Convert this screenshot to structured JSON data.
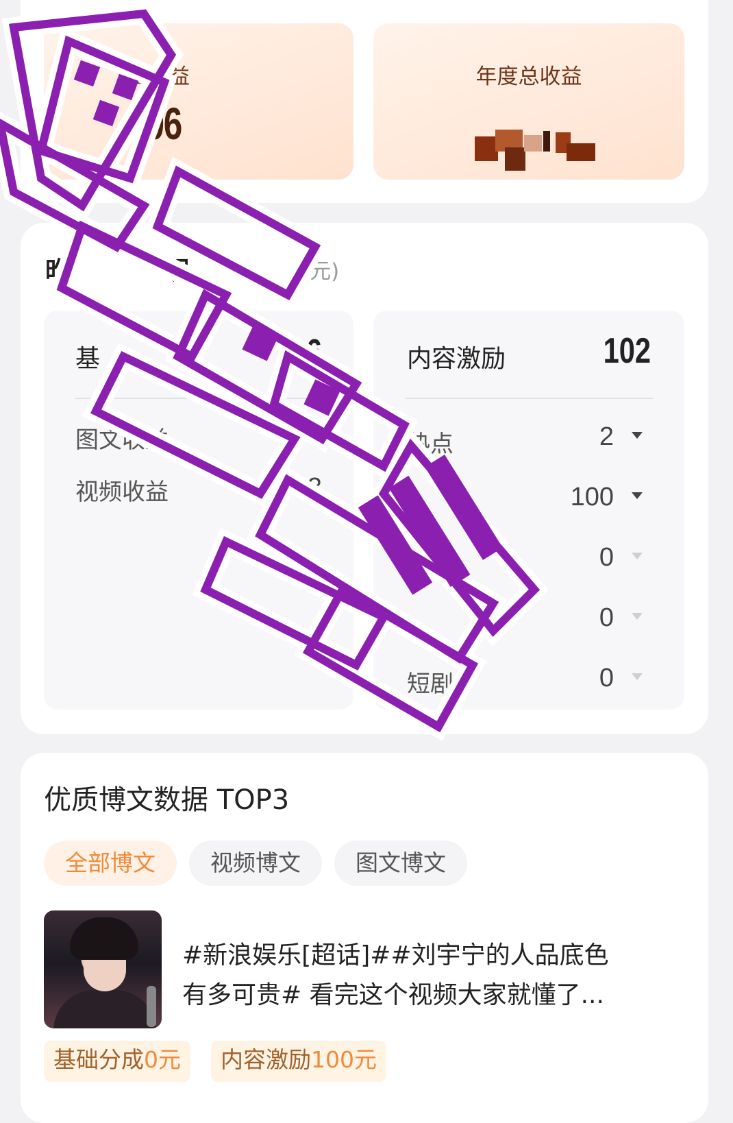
{
  "earnings": {
    "today_label": "日收益",
    "today_value": "06",
    "year_label": "年度总收益"
  },
  "detail": {
    "title": "明",
    "unit": "(元)",
    "left_top_value": "6",
    "left_rows": [
      {
        "label": "图文收益",
        "value": "5"
      },
      {
        "label": "视频收益",
        "value": ".23"
      }
    ],
    "right_header": {
      "label": "内容激励",
      "value": "102"
    },
    "right_rows": [
      {
        "label": "热点",
        "value": "2"
      },
      {
        "label": "",
        "value": "100"
      },
      {
        "label": "",
        "value": "0"
      },
      {
        "label": "",
        "value": "0"
      },
      {
        "label": "短剧",
        "value": "0"
      }
    ]
  },
  "top3": {
    "title": "优质博文数据 TOP3",
    "tabs": [
      "全部博文",
      "视频博文",
      "图文博文"
    ],
    "post": {
      "line1": "#新浪娱乐[超话]##刘宇宁的人品底色",
      "line2": "有多可贵# 看完这个视频大家就懂了..."
    },
    "tags": [
      {
        "prefix": "基础分成",
        "amount": "0元"
      },
      {
        "prefix": "内容激励",
        "amount": "100元"
      }
    ]
  },
  "colors": {
    "accent": "#f08a3a",
    "watermark": "#8a1fb0",
    "earn_bg": "#ffe8d8"
  }
}
